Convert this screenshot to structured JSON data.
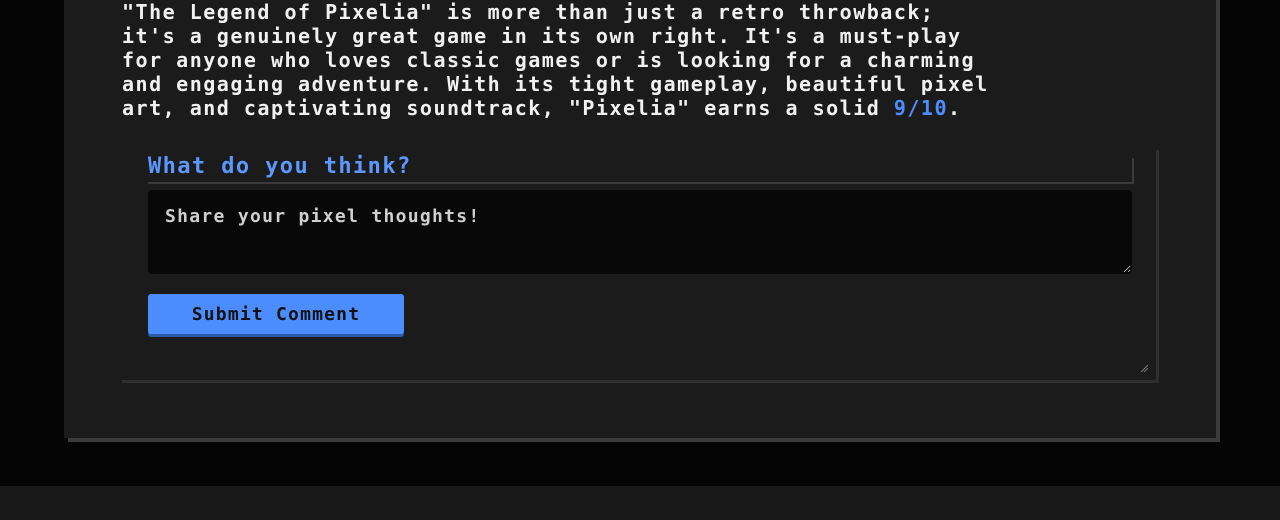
{
  "review": {
    "text_before_score": "\"The Legend of Pixelia\" is more than just a retro throwback;\nit's a genuinely great game in its own right. It's a must-play\nfor anyone who loves classic games or is looking for a charming\nand engaging adventure. With its tight gameplay, beautiful pixel\nart, and captivating soundtrack, \"Pixelia\" earns a solid ",
    "score": "9/10",
    "text_after_score": "."
  },
  "comments": {
    "heading": "What do you think?",
    "placeholder": "Share your pixel thoughts!",
    "submit_label": "Submit Comment"
  },
  "colors": {
    "background": "#050505",
    "card": "#1b1b1b",
    "accent": "#4b8cff",
    "text": "#f1f1f1"
  }
}
